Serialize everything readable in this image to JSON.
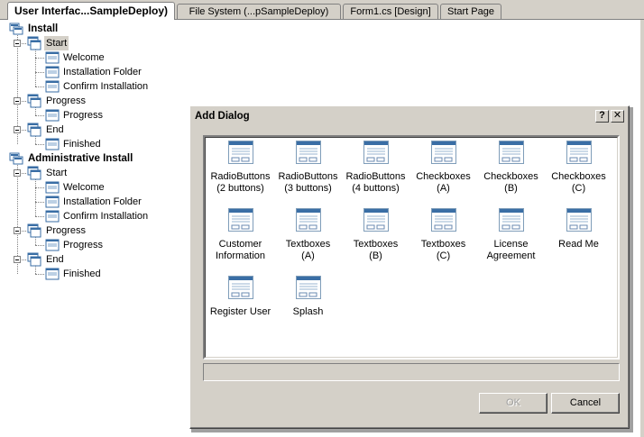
{
  "tabs": [
    {
      "label": "User Interfac...SampleDeploy)",
      "active": true
    },
    {
      "label": "File System (...pSampleDeploy)",
      "active": false
    },
    {
      "label": "Form1.cs [Design]",
      "active": false
    },
    {
      "label": "Start Page",
      "active": false
    }
  ],
  "tree": {
    "install": {
      "label": "Install",
      "start": {
        "label": "Start",
        "children": [
          "Welcome",
          "Installation Folder",
          "Confirm Installation"
        ]
      },
      "progress": {
        "label": "Progress",
        "children": [
          "Progress"
        ]
      },
      "end": {
        "label": "End",
        "children": [
          "Finished"
        ]
      }
    },
    "admin": {
      "label": "Administrative Install",
      "start": {
        "label": "Start",
        "children": [
          "Welcome",
          "Installation Folder",
          "Confirm Installation"
        ]
      },
      "progress": {
        "label": "Progress",
        "children": [
          "Progress"
        ]
      },
      "end": {
        "label": "End",
        "children": [
          "Finished"
        ]
      }
    }
  },
  "dialog": {
    "title": "Add Dialog",
    "help_btn": "?",
    "close_btn": "✕",
    "items": [
      {
        "line1": "RadioButtons",
        "line2": "(2 buttons)"
      },
      {
        "line1": "RadioButtons",
        "line2": "(3 buttons)"
      },
      {
        "line1": "RadioButtons",
        "line2": "(4 buttons)"
      },
      {
        "line1": "Checkboxes",
        "line2": "(A)"
      },
      {
        "line1": "Checkboxes",
        "line2": "(B)"
      },
      {
        "line1": "Checkboxes",
        "line2": "(C)"
      },
      {
        "line1": "Customer",
        "line2": "Information"
      },
      {
        "line1": "Textboxes",
        "line2": "(A)"
      },
      {
        "line1": "Textboxes",
        "line2": "(B)"
      },
      {
        "line1": "Textboxes",
        "line2": "(C)"
      },
      {
        "line1": "License",
        "line2": "Agreement"
      },
      {
        "line1": "Read Me",
        "line2": ""
      },
      {
        "line1": "Register User",
        "line2": ""
      },
      {
        "line1": "Splash",
        "line2": ""
      }
    ],
    "status_text": "",
    "ok_label": "OK",
    "cancel_label": "Cancel"
  },
  "colors": {
    "chrome": "#d4d0c8",
    "titlebar_icon_blue": "#3a6ea5"
  }
}
